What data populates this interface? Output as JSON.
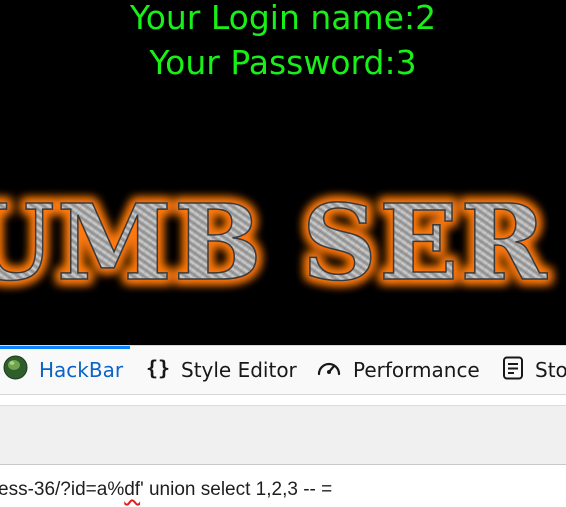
{
  "page": {
    "login_name": "Your Login name:2",
    "password": "Your Password:3",
    "banner_text": "UMB SER"
  },
  "devtools": {
    "tabs": [
      {
        "label": "HackBar",
        "icon": "hackbar-icon",
        "selected": true
      },
      {
        "label": "Style Editor",
        "icon": "braces-icon",
        "selected": false
      },
      {
        "label": "Performance",
        "icon": "gauge-icon",
        "selected": false
      },
      {
        "label": "Sto",
        "icon": "storage-icon",
        "selected": false
      }
    ]
  },
  "hackbar": {
    "url_prefix": "ess-36/?id=a%",
    "url_misspelled": "df",
    "url_suffix": "' union select 1,2,3 -- ="
  },
  "colors": {
    "login_text": "#18f118",
    "selected_tab": "#0a63c6",
    "tab_underline": "#0a84ff",
    "banner_glow": "#ff6a00"
  }
}
